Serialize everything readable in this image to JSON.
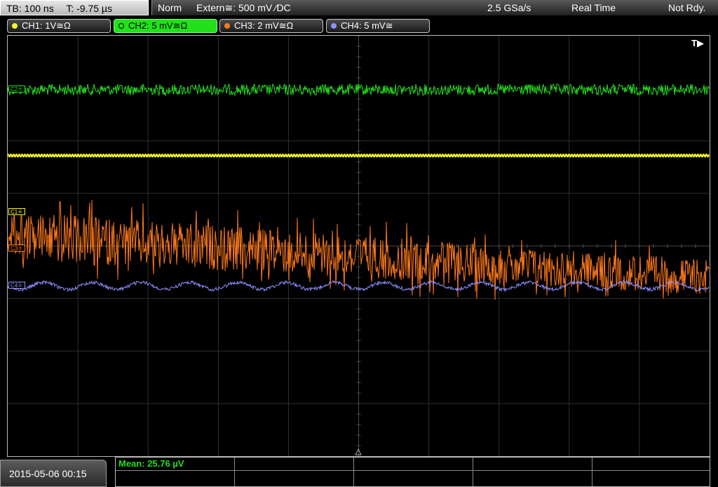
{
  "header": {
    "timebase": "TB: 100 ns",
    "trigger_time": "T: -9.75 µs",
    "mode": "Norm",
    "trigger_source": "Extern≅: 500 mV ⁄DC",
    "sample_rate": "2.5 GSa/s",
    "acq_mode": "Real Time",
    "status": "Not Rdy."
  },
  "channels": [
    {
      "id": "ch1",
      "label": "CH1: 1V≅Ω",
      "color": "#f5f52a",
      "active": false
    },
    {
      "id": "ch2",
      "label": "CH2: 5 mV≅Ω",
      "color": "#22e01a",
      "active": true
    },
    {
      "id": "ch3",
      "label": "CH3: 2 mV≅Ω",
      "color": "#ff7a1a",
      "active": false
    },
    {
      "id": "ch4",
      "label": "CH4: 5 mV≅",
      "color": "#8f8fff",
      "active": false
    }
  ],
  "screen": {
    "trigger_marker": "T▶",
    "channel_markers": [
      {
        "id": "c2",
        "label": "C2≟",
        "color": "#22e01a"
      },
      {
        "id": "c1",
        "label": "C1≟",
        "color": "#f5f52a"
      },
      {
        "id": "c3",
        "label": "C3≟",
        "color": "#ff7a1a"
      },
      {
        "id": "c4",
        "label": "C4≟",
        "color": "#8f8fff"
      }
    ]
  },
  "footer": {
    "datetime": "2015-05-06 00:15",
    "measurement": "Mean: 25.76 µV"
  }
}
